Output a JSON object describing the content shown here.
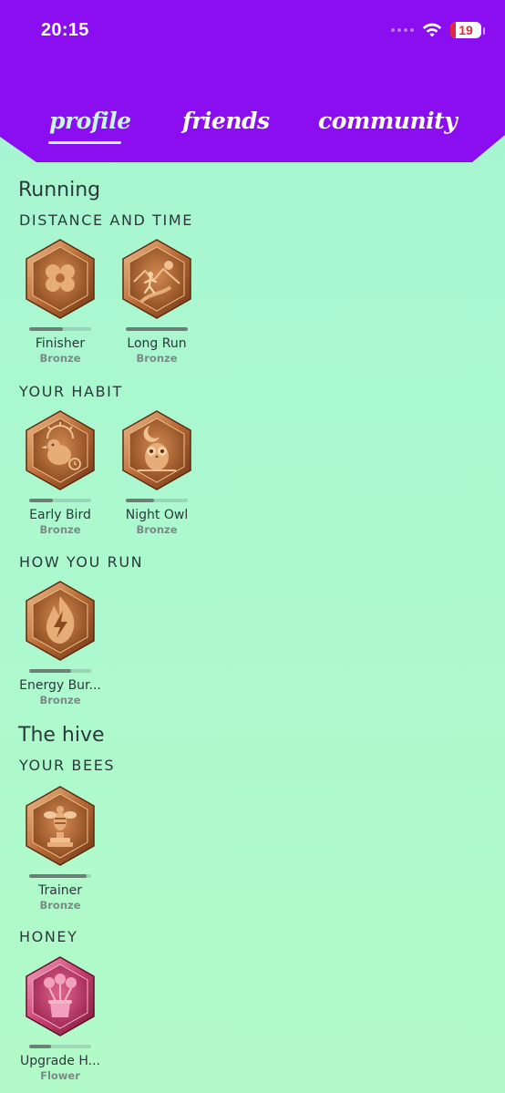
{
  "status_bar": {
    "time": "20:15",
    "battery": "19"
  },
  "tabs": [
    {
      "label": "profile",
      "active": true
    },
    {
      "label": "friends",
      "active": false
    },
    {
      "label": "community",
      "active": false
    }
  ],
  "sections": [
    {
      "title": "Running",
      "groups": [
        {
          "title": "DISTANCE AND TIME",
          "badges": [
            {
              "name": "Finisher",
              "tier": "Bronze",
              "icon": "clover-icon",
              "progress": 0.55
            },
            {
              "name": "Long Run",
              "tier": "Bronze",
              "icon": "runner-icon",
              "progress": 1.0
            }
          ]
        },
        {
          "title": "YOUR HABIT",
          "badges": [
            {
              "name": "Early Bird",
              "tier": "Bronze",
              "icon": "bird-sunrise-icon",
              "progress": 0.38
            },
            {
              "name": "Night Owl",
              "tier": "Bronze",
              "icon": "owl-moon-icon",
              "progress": 0.45
            }
          ]
        },
        {
          "title": "HOW YOU RUN",
          "badges": [
            {
              "name": "Energy Bur...",
              "tier": "Bronze",
              "icon": "flame-bolt-icon",
              "progress": 0.68
            }
          ]
        }
      ]
    },
    {
      "title": "The hive",
      "groups": [
        {
          "title": "YOUR BEES",
          "badges": [
            {
              "name": "Trainer",
              "tier": "Bronze",
              "icon": "bee-trophy-icon",
              "progress": 0.92
            }
          ]
        },
        {
          "title": "HONEY",
          "badges": [
            {
              "name": "Upgrade H...",
              "tier": "Flower",
              "icon": "flower-honey-icon",
              "progress": 0.35
            }
          ]
        }
      ]
    }
  ],
  "colors": {
    "header": "#8a0ef0",
    "bronze": "#b86a35",
    "flower": "#c83f6f"
  }
}
